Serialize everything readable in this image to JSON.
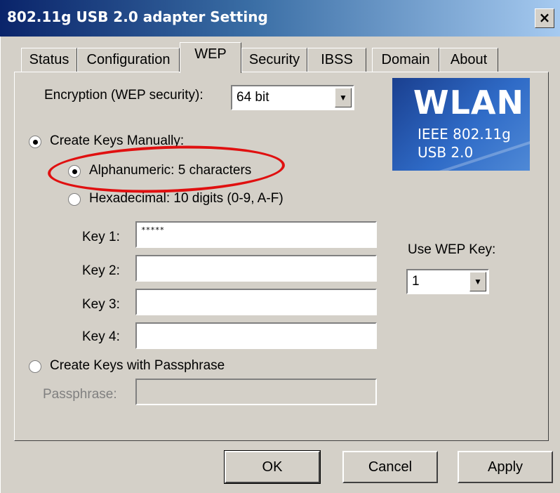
{
  "window": {
    "title": "802.11g USB 2.0 adapter Setting",
    "close_glyph": "×"
  },
  "tabs": [
    {
      "label": "Status"
    },
    {
      "label": "Configuration"
    },
    {
      "label": "WEP",
      "active": true
    },
    {
      "label": "Security"
    },
    {
      "label": "IBSS"
    },
    {
      "label": "Domain"
    },
    {
      "label": "About"
    }
  ],
  "encryption": {
    "label": "Encryption (WEP security):",
    "value": "64 bit"
  },
  "logo": {
    "brand": "WLAN",
    "line1": "IEEE 802.11g",
    "line2": "USB 2.0"
  },
  "manual": {
    "label": "Create Keys Manually:",
    "checked": true,
    "options": [
      {
        "label": "Alphanumeric: 5 characters",
        "checked": true
      },
      {
        "label": "Hexadecimal: 10 digits (0-9, A-F)",
        "checked": false
      }
    ]
  },
  "keys": [
    {
      "label": "Key 1:",
      "value": "*****"
    },
    {
      "label": "Key 2:",
      "value": ""
    },
    {
      "label": "Key 3:",
      "value": ""
    },
    {
      "label": "Key 4:",
      "value": ""
    }
  ],
  "use_key": {
    "label": "Use WEP Key:",
    "value": "1"
  },
  "passphrase": {
    "radio_label": "Create Keys with Passphrase",
    "field_label": "Passphrase:",
    "value": ""
  },
  "buttons": {
    "ok": "OK",
    "cancel": "Cancel",
    "apply": "Apply"
  },
  "colors": {
    "title_gradient_start": "#0a246a",
    "title_gradient_end": "#a6caf0",
    "dialog_face": "#d4d0c8",
    "highlight_ring": "#e01010"
  }
}
